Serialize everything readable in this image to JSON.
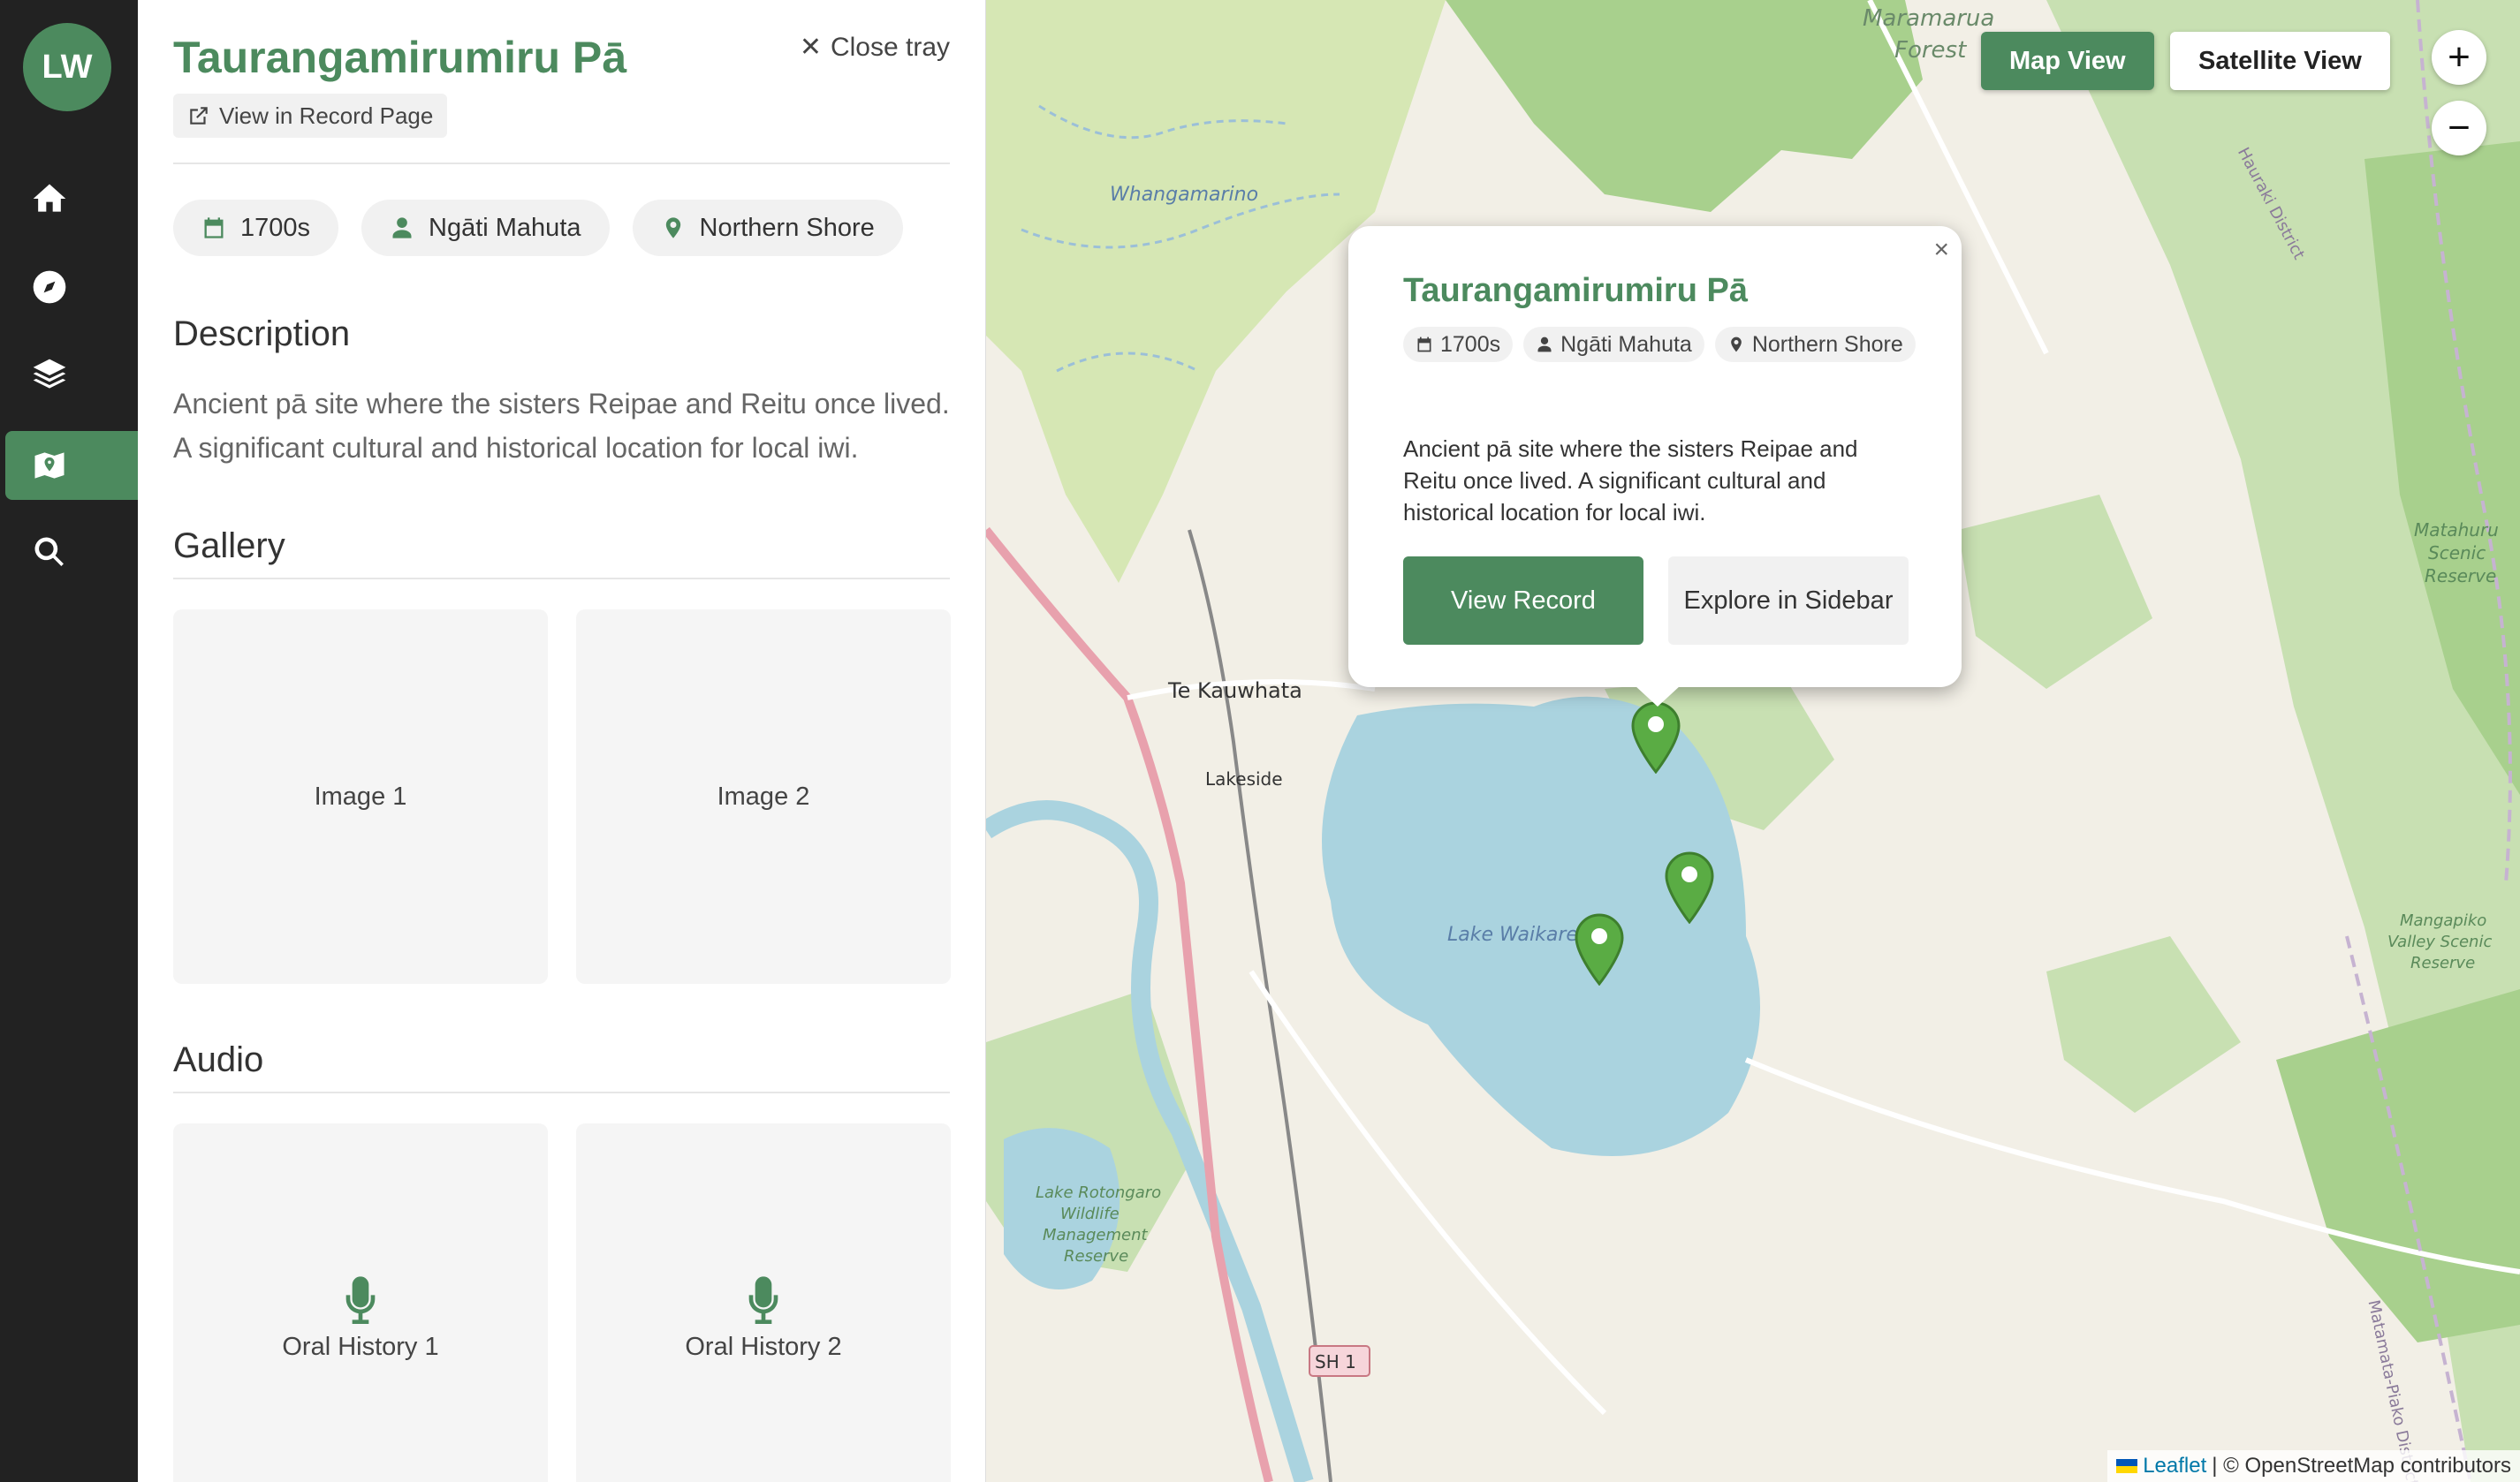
{
  "nav": {
    "logo": "LW",
    "items": [
      {
        "name": "home",
        "icon": "home-icon"
      },
      {
        "name": "explore",
        "icon": "compass-icon"
      },
      {
        "name": "layers",
        "icon": "layers-icon"
      },
      {
        "name": "map",
        "icon": "map-icon",
        "active": true
      },
      {
        "name": "search",
        "icon": "search-icon"
      }
    ]
  },
  "tray": {
    "title": "Taurangamirumiru Pā",
    "close_label": "Close tray",
    "record_link": "View in Record Page",
    "chips": {
      "period": "1700s",
      "iwi": "Ngāti Mahuta",
      "location": "Northern Shore"
    },
    "description_heading": "Description",
    "description": "Ancient pā site where the sisters Reipae and Reitu once lived. A significant cultural and historical location for local iwi.",
    "gallery_heading": "Gallery",
    "gallery": [
      "Image 1",
      "Image 2"
    ],
    "audio_heading": "Audio",
    "audio": [
      "Oral History 1",
      "Oral History 2"
    ]
  },
  "map": {
    "view_toggle": {
      "map": "Map View",
      "satellite": "Satellite View",
      "selected": "Map View"
    },
    "zoom_in": "+",
    "zoom_out": "−",
    "labels": {
      "maramarua": "Maramarua",
      "forest": "Forest",
      "whangamarino": "Whangamarino",
      "te_kauwhata": "Te Kauwhata",
      "lakeside": "Lakeside",
      "lake_waikare": "Lake Waikare",
      "hauraki_district": "Hauraki District",
      "matahuru_1": "Matahuru",
      "matahuru_2": "Scenic",
      "matahuru_3": "Reserve",
      "mangapiko_1": "Mangapiko",
      "mangapiko_2": "Valley Scenic",
      "mangapiko_3": "Reserve",
      "rotongaro_1": "Lake Rotongaro",
      "rotongaro_2": "Wildlife",
      "rotongaro_3": "Management",
      "rotongaro_4": "Reserve",
      "sh1": "SH 1",
      "matamata_district": "Matamata-Piako District"
    },
    "attribution": {
      "leaflet": "Leaflet",
      "osm": "| © OpenStreetMap contributors"
    },
    "colors": {
      "water": "#aad3df",
      "park": "#c8e0b2",
      "forest": "#a8d08d",
      "wetland": "#d6e7b4",
      "marker": "#5aac44",
      "accent": "#4c8a5e"
    }
  },
  "popup": {
    "title": "Taurangamirumiru Pā",
    "close": "×",
    "period": "1700s",
    "iwi": "Ngāti Mahuta",
    "location": "Northern Shore",
    "description": "Ancient pā site where the sisters Reipae and Reitu once lived. A significant cultural and historical location for local iwi.",
    "primary_button": "View Record",
    "secondary_button": "Explore in Sidebar"
  }
}
